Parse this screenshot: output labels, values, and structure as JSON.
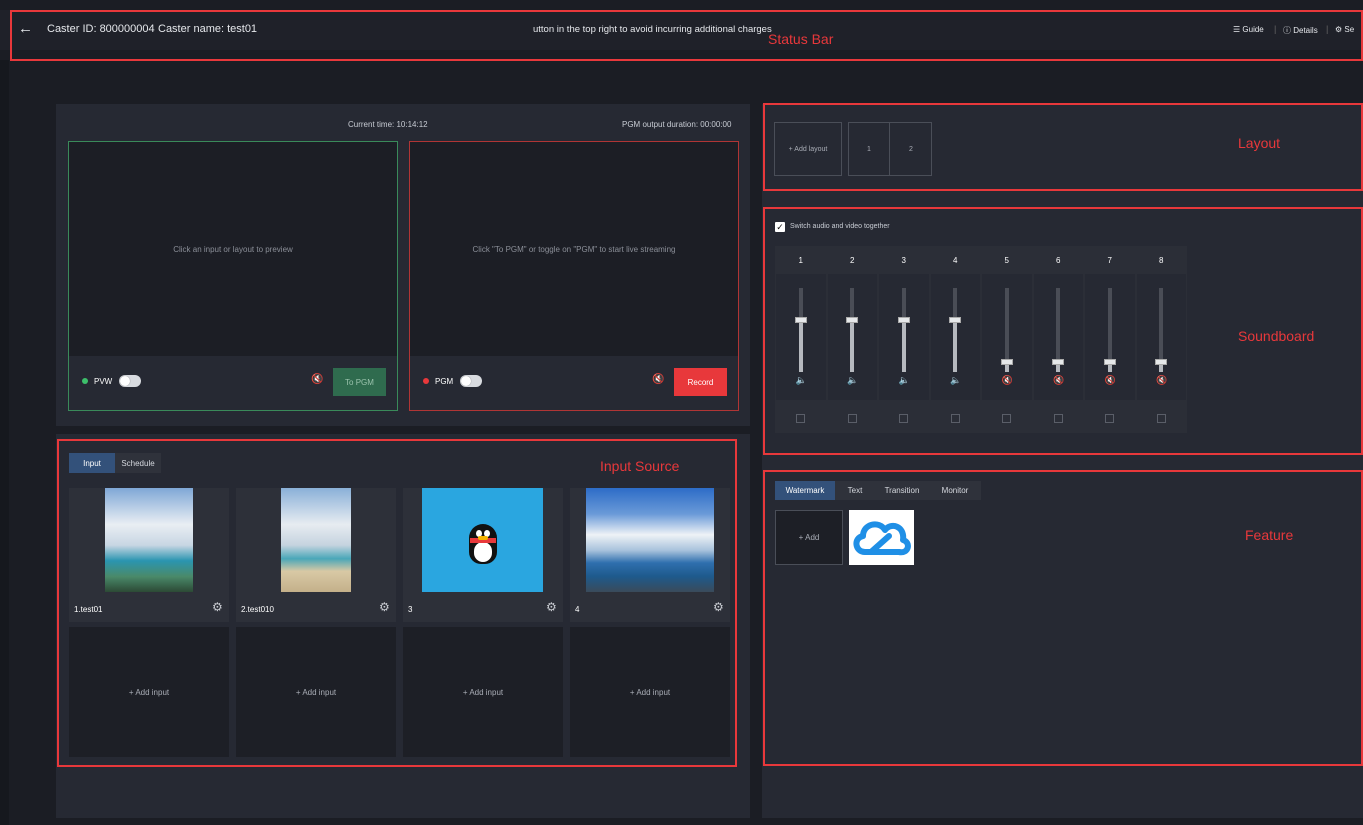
{
  "status_bar": {
    "back_icon": "arrow-left-icon",
    "caster_id": "Caster ID: 800000004",
    "caster_name": "Caster name: test01",
    "notice": "utton in the top right to avoid incurring additional charges",
    "guide": "Guide",
    "details": "Details",
    "settings": "Se"
  },
  "annotations": {
    "status_bar": "Status Bar",
    "layout": "Layout",
    "soundboard": "Soundboard",
    "input_source": "Input Source",
    "feature": "Feature"
  },
  "preview": {
    "current_time": "Current time: 10:14:12",
    "pgm_duration": "PGM output duration: 00:00:00",
    "pvw_hint": "Click an input or layout to preview",
    "pgm_hint": "Click \"To PGM\" or toggle on \"PGM\" to start live streaming",
    "pvw_label": "PVW",
    "pgm_label": "PGM",
    "to_pgm": "To PGM",
    "record": "Record"
  },
  "layout": {
    "add_layout": "+ Add layout",
    "cells": [
      "1",
      "2"
    ]
  },
  "soundboard": {
    "sync_label": "Switch audio and video together",
    "sync_checked": true,
    "channels": [
      {
        "label": "1",
        "level": 0.62,
        "muted": false
      },
      {
        "label": "2",
        "level": 0.62,
        "muted": false
      },
      {
        "label": "3",
        "level": 0.62,
        "muted": false
      },
      {
        "label": "4",
        "level": 0.62,
        "muted": false
      },
      {
        "label": "5",
        "level": 0.12,
        "muted": true
      },
      {
        "label": "6",
        "level": 0.12,
        "muted": true
      },
      {
        "label": "7",
        "level": 0.12,
        "muted": true
      },
      {
        "label": "8",
        "level": 0.12,
        "muted": true
      }
    ]
  },
  "input_source": {
    "tabs": [
      "Input",
      "Schedule"
    ],
    "inputs": [
      {
        "name": "1.test01",
        "thumb": "beach-cliff-photo"
      },
      {
        "name": "2.test010",
        "thumb": "sandy-beach-photo"
      },
      {
        "name": "3",
        "thumb": "penguin-logo"
      },
      {
        "name": "4",
        "thumb": "pier-sky-photo"
      }
    ],
    "add_input": "+ Add input"
  },
  "feature": {
    "tabs": [
      "Watermark",
      "Text",
      "Transition",
      "Monitor"
    ],
    "add": "+ Add",
    "watermark_icon": "cloud-logo-icon"
  },
  "colors": {
    "accent_red": "#e8383b",
    "pvw_green": "#3dbf6b",
    "tab_blue": "#33517a"
  }
}
